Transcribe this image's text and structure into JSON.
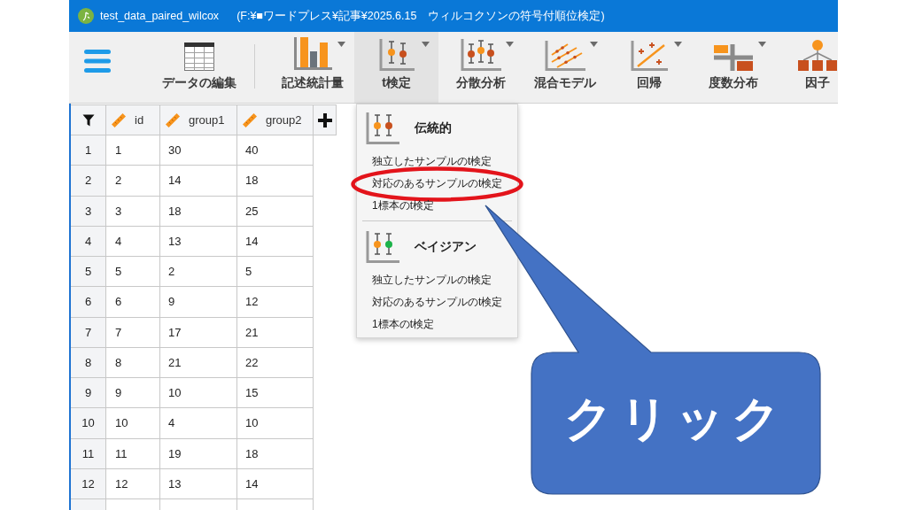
{
  "window": {
    "title": "test_data_paired_wilcox",
    "path": "(F:¥■ワードプレス¥記事¥2025.6.15　ウィルコクソンの符号付順位検定)"
  },
  "toolbar": [
    {
      "label": "データの編集",
      "kind": "table",
      "dropdown": false,
      "selected": false,
      "separator_after": true
    },
    {
      "label": "記述統計量",
      "kind": "bars",
      "dropdown": true,
      "selected": false,
      "separator_after": false
    },
    {
      "label": "t検定",
      "kind": "ttest",
      "dropdown": true,
      "selected": true,
      "separator_after": false
    },
    {
      "label": "分散分析",
      "kind": "anova",
      "dropdown": true,
      "selected": false,
      "separator_after": false
    },
    {
      "label": "混合モデル",
      "kind": "mixed",
      "dropdown": true,
      "selected": false,
      "separator_after": false
    },
    {
      "label": "回帰",
      "kind": "regression",
      "dropdown": true,
      "selected": false,
      "separator_after": false
    },
    {
      "label": "度数分布",
      "kind": "frequencies",
      "dropdown": true,
      "selected": false,
      "separator_after": false
    },
    {
      "label": "因子",
      "kind": "factor",
      "dropdown": false,
      "selected": false,
      "separator_after": false
    }
  ],
  "table": {
    "columns": [
      {
        "name": "id"
      },
      {
        "name": "group1"
      },
      {
        "name": "group2"
      }
    ],
    "rows": [
      {
        "number": "1",
        "cells": [
          "1",
          "30",
          "40"
        ]
      },
      {
        "number": "2",
        "cells": [
          "2",
          "14",
          "18"
        ]
      },
      {
        "number": "3",
        "cells": [
          "3",
          "18",
          "25"
        ]
      },
      {
        "number": "4",
        "cells": [
          "4",
          "13",
          "14"
        ]
      },
      {
        "number": "5",
        "cells": [
          "5",
          "2",
          "5"
        ]
      },
      {
        "number": "6",
        "cells": [
          "6",
          "9",
          "12"
        ]
      },
      {
        "number": "7",
        "cells": [
          "7",
          "17",
          "21"
        ]
      },
      {
        "number": "8",
        "cells": [
          "8",
          "21",
          "22"
        ]
      },
      {
        "number": "9",
        "cells": [
          "9",
          "10",
          "15"
        ]
      },
      {
        "number": "10",
        "cells": [
          "10",
          "4",
          "10"
        ]
      },
      {
        "number": "11",
        "cells": [
          "11",
          "19",
          "18"
        ]
      },
      {
        "number": "12",
        "cells": [
          "12",
          "13",
          "14"
        ]
      }
    ]
  },
  "menu": {
    "sections": [
      {
        "title": "伝統的",
        "kind": "classical",
        "items": [
          {
            "label": "独立したサンプルのt検定",
            "circled": false
          },
          {
            "label": "対応のあるサンプルのt検定",
            "circled": true
          },
          {
            "label": "1標本のt検定",
            "circled": false
          }
        ]
      },
      {
        "title": "ベイジアン",
        "kind": "bayesian",
        "items": [
          {
            "label": "独立したサンプルのt検定",
            "circled": false
          },
          {
            "label": "対応のあるサンプルのt検定",
            "circled": false
          },
          {
            "label": "1標本のt検定",
            "circled": false
          }
        ]
      }
    ]
  },
  "callout": {
    "text": "クリック"
  }
}
